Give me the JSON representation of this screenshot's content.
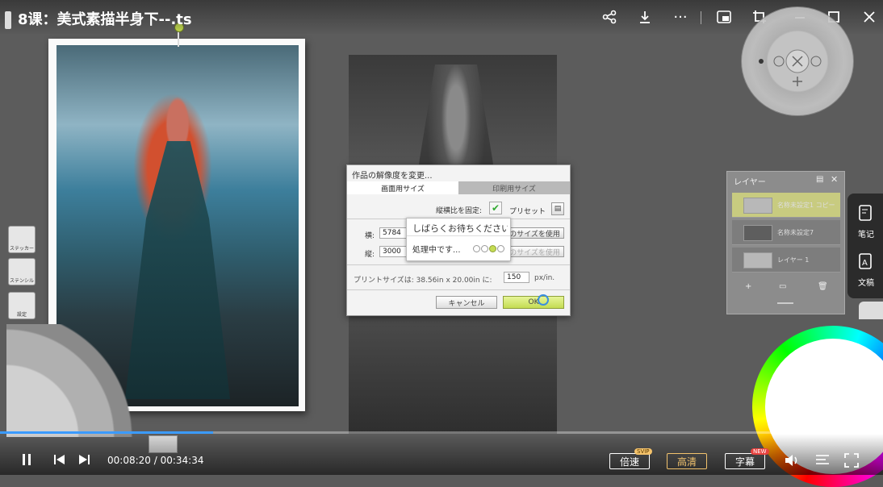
{
  "window": {
    "title": "8课：美式素描半身下--.ts"
  },
  "dialog": {
    "title": "作品の解像度を変更...",
    "tabs": [
      "画面用サイズ",
      "印刷用サイズ"
    ],
    "aspect_label": "縦横比を固定:",
    "preset_label": "プリセット",
    "width_label": "横:",
    "width_value": "5784",
    "height_label": "縦:",
    "height_value": "3000",
    "use_size_btn": "のサイズを使用",
    "use_size_btn2": "のサイズを使用",
    "print_size_text": "プリントサイズは: 38.56in x 20.00in に:",
    "ppi_value": "150",
    "ppi_unit": "px/in.",
    "cancel": "キャンセル",
    "ok": "OK"
  },
  "popup": {
    "message": "しばらくお待ちください",
    "processing": "処理中です..."
  },
  "layer_panel": {
    "title": "レイヤー",
    "layers": [
      {
        "name": "名称未設定1 コピー"
      },
      {
        "name": "名称未設定7"
      },
      {
        "name": "レイヤー 1"
      }
    ]
  },
  "side_panel": {
    "notes": "笔记",
    "doc": "文稿"
  },
  "tools": {
    "sticker": "ステッカー",
    "stencil": "ステンシル",
    "settings": "設定"
  },
  "player": {
    "time": "00:08:20 / 00:34:34",
    "progress": 0.241,
    "speed": "倍速",
    "speed_badge": "SVIP",
    "quality": "高清",
    "subtitle": "字幕",
    "subtitle_badge": "NEW"
  },
  "colors": {
    "accent": "#3b9bff",
    "ok_green": "#c4dc52"
  }
}
